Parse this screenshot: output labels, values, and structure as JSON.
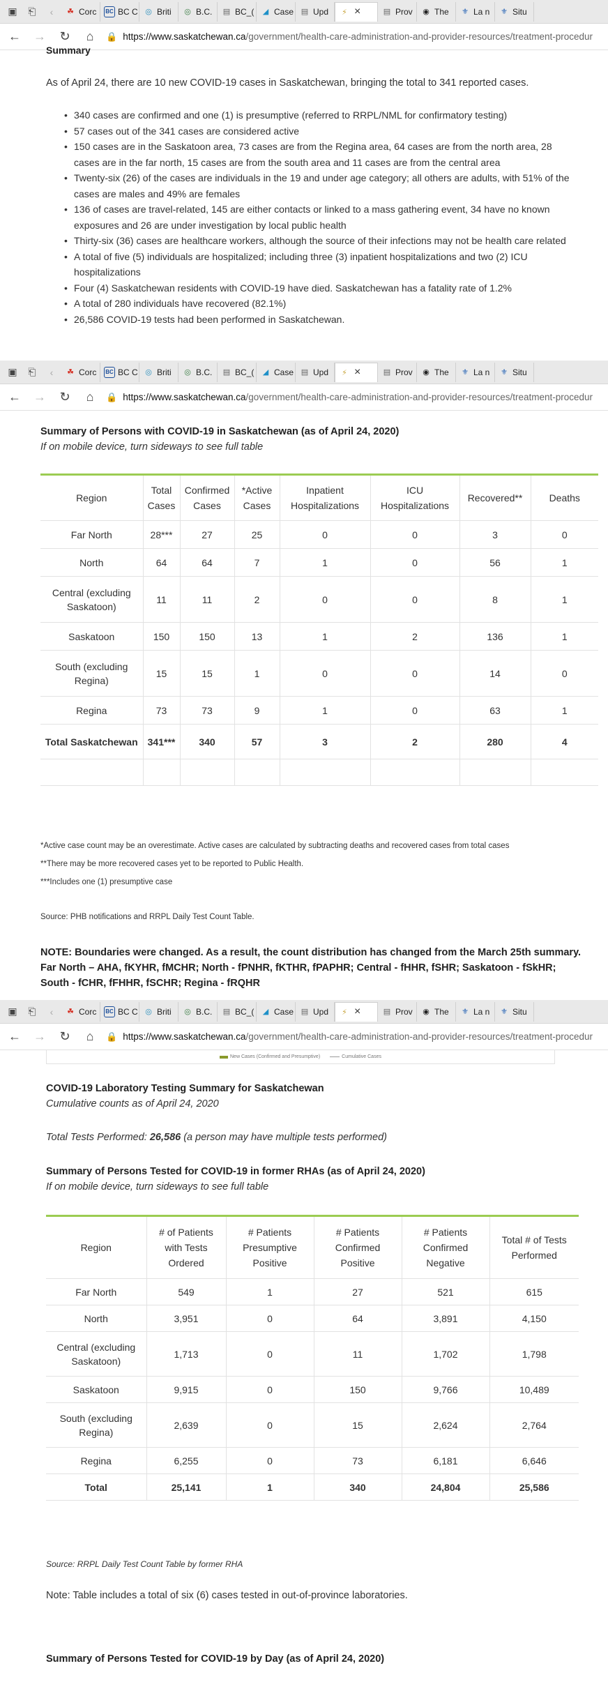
{
  "browser": {
    "tabs": [
      {
        "label": "Corc",
        "icon": "maple-leaf-icon",
        "color": "#d52b1e"
      },
      {
        "label": "BC C",
        "icon": "bc-cdc-icon",
        "color": "#1b4e9b"
      },
      {
        "label": "Briti",
        "icon": "globe-icon",
        "color": "#2a8fbd"
      },
      {
        "label": "B.C.",
        "icon": "globe-icon",
        "color": "#3a7d44"
      },
      {
        "label": "BC_(",
        "icon": "document-icon",
        "color": "#666666"
      },
      {
        "label": "Case",
        "icon": "chart-icon",
        "color": "#1e90c8"
      },
      {
        "label": "Upd",
        "icon": "document-icon",
        "color": "#666666"
      },
      {
        "label": "",
        "icon": "active-tab-icon",
        "color": "#c8a43c"
      },
      {
        "label": "Prov",
        "icon": "document-icon",
        "color": "#666666"
      },
      {
        "label": "The",
        "icon": "shield-icon",
        "color": "#222222"
      },
      {
        "label": "La n",
        "icon": "quebec-fleur-icon",
        "color": "#1f5fb4"
      },
      {
        "label": "Situ",
        "icon": "quebec-fleur-icon",
        "color": "#1f5fb4"
      }
    ],
    "url_host": "https://www.saskatchewan.ca",
    "url_path": "/government/health-care-administration-and-provider-resources/treatment-procedur"
  },
  "summary": {
    "heading": "Summary",
    "intro": "As of April 24, there are 10 new COVID-19 cases in Saskatchewan, bringing the total to 341 reported cases.",
    "bullets": [
      "340 cases are confirmed and one (1) is presumptive (referred to RRPL/NML for confirmatory testing)",
      "57 cases out of the 341 cases are considered active",
      "150 cases are in the Saskatoon area, 73 cases are from the Regina area, 64 cases are from the north area,  28 cases are in the far north, 15 cases are from the south area and 11 cases are from the central area",
      "Twenty-six (26) of the cases are individuals in the 19 and under age category; all others are adults, with 51% of the cases are males and 49% are females",
      "136 of cases are travel-related, 145 are either contacts or linked to a mass gathering event, 34 have no known exposures and 26 are under investigation by local public health",
      "Thirty-six (36) cases are healthcare workers, although the source of their infections may not be health care related",
      "A total of five (5) individuals are hospitalized; including three (3) inpatient hospitalizations and two (2) ICU hospitalizations",
      "Four (4) Saskatchewan residents with COVID-19 have died. Saskatchewan has a fatality rate of 1.2%",
      "A total of 280 individuals have recovered (82.1%)",
      "26,586 COVID-19 tests had been performed in Saskatchewan."
    ]
  },
  "persons": {
    "title": "Summary of Persons with COVID-19 in Saskatchewan (as of April 24, 2020)",
    "subtitle": "If on mobile device, turn sideways to see full table",
    "headers": [
      "Region",
      "Total Cases",
      "Confirmed Cases",
      "*Active Cases",
      "Inpatient Hospitalizations",
      "ICU Hospitalizations",
      "Recovered**",
      "Deaths"
    ],
    "rows": [
      [
        "Far North",
        "28***",
        "27",
        "25",
        "0",
        "0",
        "3",
        "0"
      ],
      [
        "North",
        "64",
        "64",
        "7",
        "1",
        "0",
        "56",
        "1"
      ],
      [
        "Central (excluding Saskatoon)",
        "11",
        "11",
        "2",
        "0",
        "0",
        "8",
        "1"
      ],
      [
        "Saskatoon",
        "150",
        "150",
        "13",
        "1",
        "2",
        "136",
        "1"
      ],
      [
        "South (excluding Regina)",
        "15",
        "15",
        "1",
        "0",
        "0",
        "14",
        "0"
      ],
      [
        "Regina",
        "73",
        "73",
        "9",
        "1",
        "0",
        "63",
        "1"
      ]
    ],
    "total": [
      "Total Saskatchewan",
      "341***",
      "340",
      "57",
      "3",
      "2",
      "280",
      "4"
    ],
    "footnotes": [
      "*Active case count may be an overestimate. Active cases are calculated by subtracting deaths and recovered cases from total cases",
      "**There may be more recovered cases yet to be reported to Public Health.",
      "***Includes one (1) presumptive case"
    ],
    "source": "Source: PHB notifications and RRPL Daily Test Count Table.",
    "note": "NOTE: Boundaries were changed. As a result, the count distribution has changed from the March 25th summary. Far North – AHA, fKYHR, fMCHR; North - fPNHR, fKTHR, fPAPHR; Central - fHHR, fSHR; Saskatoon - fSkHR; South - fCHR, fFHHR, fSCHR; Regina - fRQHR"
  },
  "chart_legend": {
    "new_cases": "New Cases (Confirmed and Presumptive)",
    "cumulative": "Cumulative Cases",
    "new_color": "#8a9a2c",
    "cumulative_color": "#9a9a9a"
  },
  "lab": {
    "title": "COVID-19 Laboratory Testing Summary for Saskatchewan",
    "subtitle": "Cumulative counts as of April 24, 2020",
    "total_prefix": "Total Tests Performed: ",
    "total_value": "26,586",
    "total_suffix": " (a person may have multiple tests performed)"
  },
  "tested": {
    "title": "Summary of Persons Tested for COVID-19 in former RHAs (as of April 24, 2020)",
    "subtitle": "If on mobile device, turn sideways to see full table",
    "headers": [
      "Region",
      "# of Patients with Tests Ordered",
      "# Patients Presumptive Positive",
      "# Patients Confirmed Positive",
      "# Patients Confirmed Negative",
      "Total # of Tests Performed"
    ],
    "rows": [
      [
        "Far North",
        "549",
        "1",
        "27",
        "521",
        "615"
      ],
      [
        "North",
        "3,951",
        "0",
        "64",
        "3,891",
        "4,150"
      ],
      [
        "Central (excluding Saskatoon)",
        "1,713",
        "0",
        "11",
        "1,702",
        "1,798"
      ],
      [
        "Saskatoon",
        "9,915",
        "0",
        "150",
        "9,766",
        "10,489"
      ],
      [
        "South (excluding Regina)",
        "2,639",
        "0",
        "15",
        "2,624",
        "2,764"
      ],
      [
        "Regina",
        "6,255",
        "0",
        "73",
        "6,181",
        "6,646"
      ]
    ],
    "total": [
      "Total",
      "25,141",
      "1",
      "340",
      "24,804",
      "25,586"
    ],
    "source": "Source: RRPL Daily Test Count Table by former RHA",
    "note": "Note: Table includes a total of six (6) cases tested in out-of-province laboratories.",
    "next_title": "Summary of Persons Tested for COVID-19 by Day (as of April 24, 2020)"
  }
}
